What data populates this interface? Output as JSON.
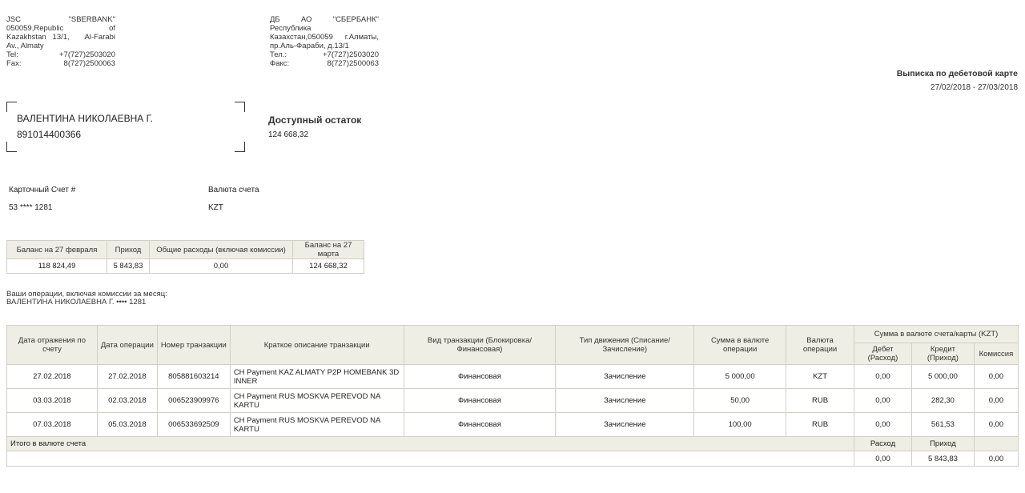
{
  "bank_en": {
    "line1": [
      "JSC",
      "\"SBERBANK\""
    ],
    "line2": [
      "050059,Republic",
      "of"
    ],
    "line3": [
      "Kazakhstan   13/1,",
      "Al-Farabi"
    ],
    "line4": "Av., Almaty",
    "tel": [
      "Tel:",
      "+7(727)2503020"
    ],
    "fax": [
      "Fax:",
      "8(727)2500063"
    ]
  },
  "bank_ru": {
    "line1": [
      "ДБ",
      "АО",
      "\"СБЕРБАНК\""
    ],
    "line2": "Республика",
    "line3": [
      "Казахстан,050059",
      "г.Алматы,"
    ],
    "line4": "пр.Аль-Фараби, д.13/1",
    "tel": [
      "Тел.:",
      "+7(727)2503020"
    ],
    "fax": [
      "Факс:",
      "8(727)2500063"
    ]
  },
  "statement": {
    "title": "Выписка по дебетовой карте",
    "period": "27/02/2018 - 27/03/2018"
  },
  "client": {
    "name": "ВАЛЕНТИНА НИКОЛАЕВНА Г.",
    "id": "891014400366"
  },
  "available": {
    "label": "Доступный остаток",
    "value": "124 668,32"
  },
  "account": {
    "number_label": "Карточный Счет #",
    "number": "53 **** 1281",
    "currency_label": "Валюта счета",
    "currency": "KZT"
  },
  "summary": {
    "headers": [
      "Баланс на 27 февраля",
      "Приход",
      "Общие расходы (включая комиссии)",
      "Баланс на 27 марта"
    ],
    "values": [
      "118 824,49",
      "5 843,83",
      "0,00",
      "124 668,32"
    ]
  },
  "operations_intro": {
    "line1": "Ваши операции, включая комиссии за месяц:",
    "line2": "ВАЛЕНТИНА НИКОЛАЕВНА Г. •••• 1281"
  },
  "transactions": {
    "headers": {
      "posting_date": "Дата отражения по счету",
      "op_date": "Дата операции",
      "number": "Номер транзакции",
      "description": "Краткое описание транзакции",
      "type": "Вид транзакции (Блокировка/Финансовая)",
      "movement": "Тип движения (Списание/Зачисление)",
      "amount": "Сумма в валюте операции",
      "currency": "Валюта операции",
      "group": "Сумма в валюте счета/карты (KZT)",
      "debit": "Дебет (Расход)",
      "credit": "Кредит (Приход)",
      "fee": "Комиссия"
    },
    "rows": [
      {
        "posting_date": "27.02.2018",
        "op_date": "27.02.2018",
        "number": "805881603214",
        "description": "CH Payment KAZ ALMATY P2P HOMEBANK 3D INNER",
        "type": "Финансовая",
        "movement": "Зачисление",
        "amount": "5 000,00",
        "currency": "KZT",
        "debit": "0,00",
        "credit": "5 000,00",
        "fee": "0,00"
      },
      {
        "posting_date": "03.03.2018",
        "op_date": "02.03.2018",
        "number": "006523909976",
        "description": "CH Payment RUS MOSKVA PEREVOD NA KARTU",
        "type": "Финансовая",
        "movement": "Зачисление",
        "amount": "50,00",
        "currency": "RUB",
        "debit": "0,00",
        "credit": "282,30",
        "fee": "0,00"
      },
      {
        "posting_date": "07.03.2018",
        "op_date": "05.03.2018",
        "number": "006533692509",
        "description": "CH Payment RUS MOSKVA PEREVOD NA KARTU",
        "type": "Финансовая",
        "movement": "Зачисление",
        "amount": "100,00",
        "currency": "RUB",
        "debit": "0,00",
        "credit": "561,53",
        "fee": "0,00"
      }
    ],
    "total": {
      "label": "Итого в валюте счета",
      "debit_label": "Расход",
      "credit_label": "Приход",
      "debit": "0,00",
      "credit": "5 843,83",
      "fee": "0,00"
    }
  }
}
